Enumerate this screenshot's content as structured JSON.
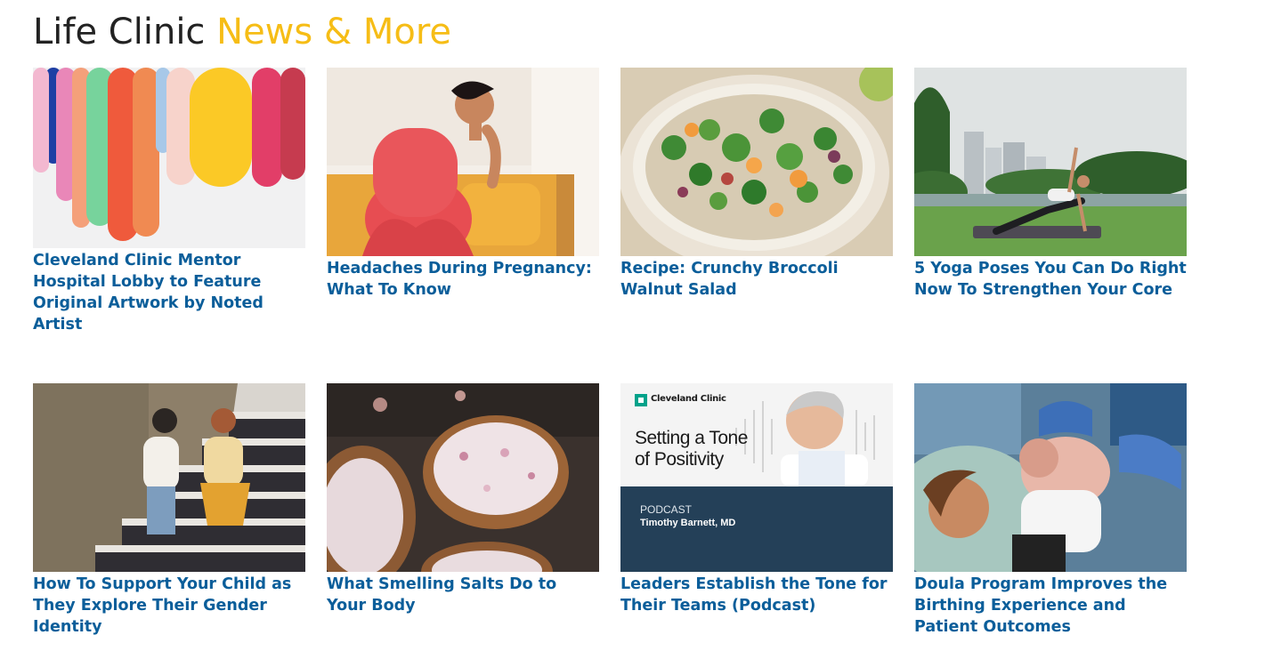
{
  "section": {
    "title_part1": "Life Clinic",
    "title_part2": "News & More"
  },
  "colors": {
    "title": "#222222",
    "accent": "#f6bd16",
    "link": "#0b5e9a"
  },
  "articles": [
    {
      "title": "Cleveland Clinic Mentor Hospital Lobby to Feature Original Artwork by Noted Artist",
      "image": "colorful-hanging-artwork"
    },
    {
      "title": "Headaches During Pregnancy: What To Know",
      "image": "pregnant-woman-on-sofa"
    },
    {
      "title": "Recipe: Crunchy Broccoli Walnut Salad",
      "image": "broccoli-salad-bowl"
    },
    {
      "title": "5 Yoga Poses You Can Do Right Now To Strengthen Your Core",
      "image": "yoga-side-plank-park"
    },
    {
      "title": "How To Support Your Child as They Explore Their Gender Identity",
      "image": "two-kids-on-tiled-steps"
    },
    {
      "title": "What Smelling Salts Do to Your Body",
      "image": "bowls-of-bath-salts"
    },
    {
      "title": "Leaders Establish the Tone for Their Teams (Podcast)",
      "image": "podcast-cover"
    },
    {
      "title": "Doula Program Improves the Birthing Experience and Patient Outcomes",
      "image": "newborn-delivery"
    }
  ],
  "podcast_cover": {
    "brand": "Cleveland Clinic",
    "headline_line1": "Setting a Tone",
    "headline_line2": "of Positivity",
    "kicker": "PODCAST",
    "guest": "Timothy Barnett, MD"
  }
}
